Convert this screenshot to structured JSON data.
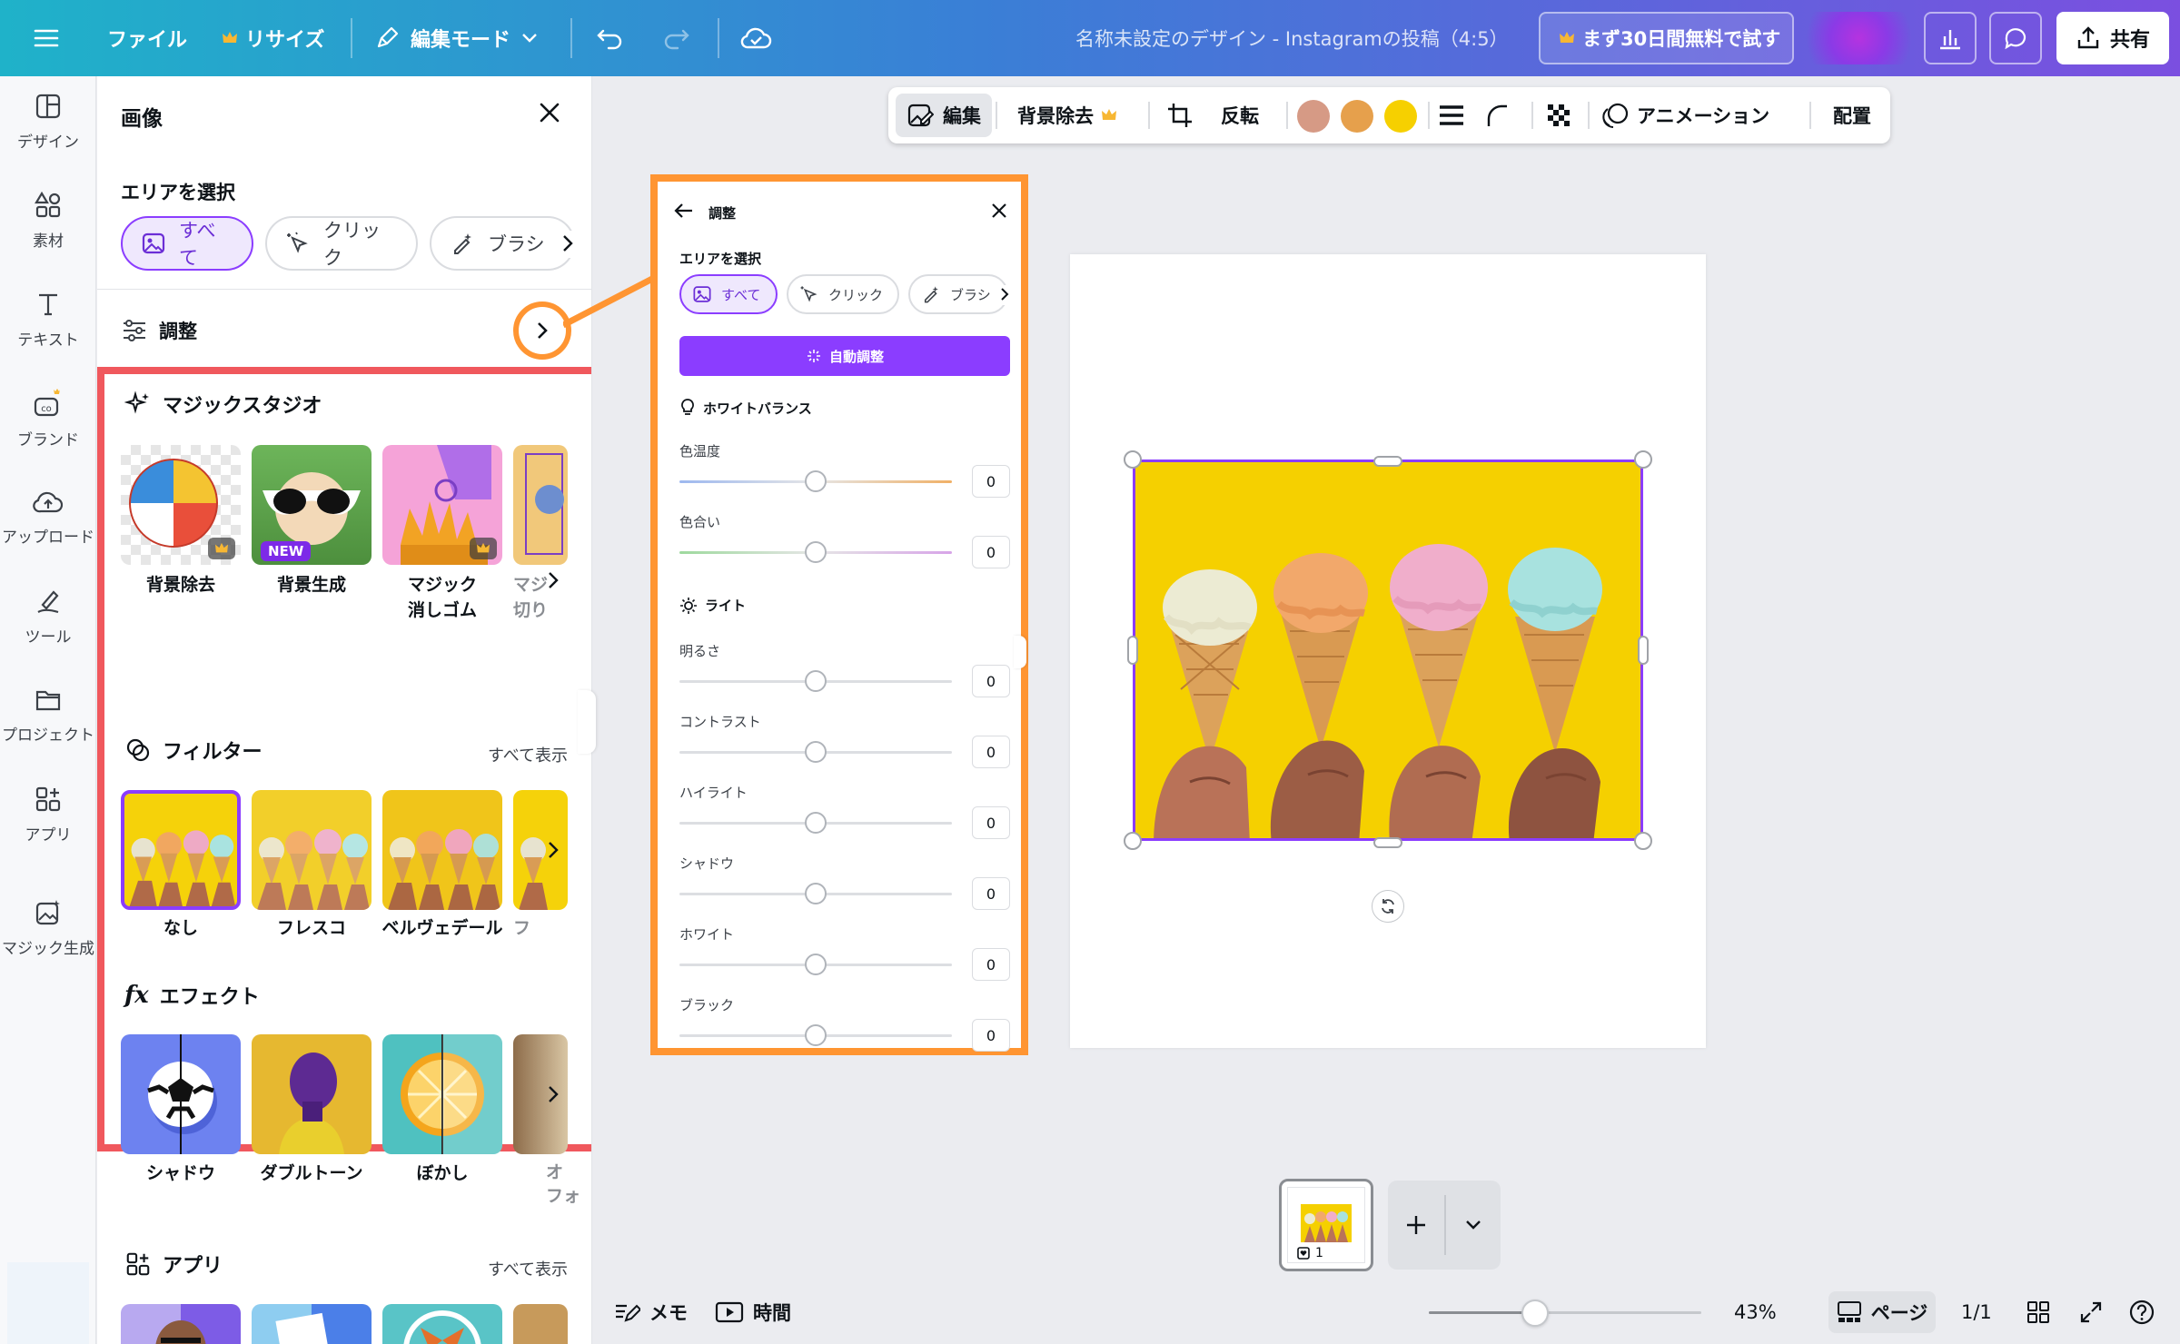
{
  "topbar": {
    "file": "ファイル",
    "resize": "リサイズ",
    "edit_mode": "編集モード",
    "doc_title": "名称未設定のデザイン - Instagramの投稿（4:5）",
    "trial": "まず30日間無料で試す",
    "share": "共有"
  },
  "rail": {
    "items": [
      "デザイン",
      "素材",
      "テキスト",
      "ブランド",
      "アップロード",
      "ツール",
      "プロジェクト",
      "アプリ",
      "マジック生成"
    ]
  },
  "panel": {
    "title": "画像",
    "area_select": "エリアを選択",
    "chips": [
      "すべて",
      "クリック",
      "ブラシ"
    ],
    "adjust": "調整",
    "magic_studio": {
      "title": "マジックスタジオ",
      "items": [
        "背景除去",
        "背景生成",
        "マジック\n消しゴム",
        "マジ\n切り"
      ],
      "new_badge": "NEW"
    },
    "filters": {
      "title": "フィルター",
      "show_all": "すべて表示",
      "items": [
        "なし",
        "フレスコ",
        "ベルヴェデール",
        "フ"
      ]
    },
    "effects": {
      "title": "エフェクト",
      "items": [
        "シャドウ",
        "ダブルトーン",
        "ぼかし",
        "オ\nフォ"
      ]
    },
    "apps": {
      "title": "アプリ",
      "show_all": "すべて表示"
    }
  },
  "editbar": {
    "edit": "編集",
    "bg_remove": "背景除去",
    "flip": "反転",
    "animation": "アニメーション",
    "position": "配置",
    "swatches": [
      "#d69a85",
      "#e6a04c",
      "#f6d000"
    ]
  },
  "adjust_panel": {
    "title": "調整",
    "area_select": "エリアを選択",
    "chips": [
      "すべて",
      "クリック",
      "ブラシ"
    ],
    "auto": "自動調整",
    "white_balance": "ホワイトバランス",
    "light": "ライト",
    "sliders_wb": [
      {
        "label": "色温度",
        "value": "0"
      },
      {
        "label": "色合い",
        "value": "0"
      }
    ],
    "sliders_light": [
      {
        "label": "明るさ",
        "value": "0"
      },
      {
        "label": "コントラスト",
        "value": "0"
      },
      {
        "label": "ハイライト",
        "value": "0"
      },
      {
        "label": "シャドウ",
        "value": "0"
      },
      {
        "label": "ホワイト",
        "value": "0"
      },
      {
        "label": "ブラック",
        "value": "0"
      }
    ]
  },
  "bottombar": {
    "memo": "メモ",
    "time": "時間",
    "zoom": "43%",
    "page_label": "ページ",
    "page_count": "1/1",
    "thumb_page": "1"
  }
}
